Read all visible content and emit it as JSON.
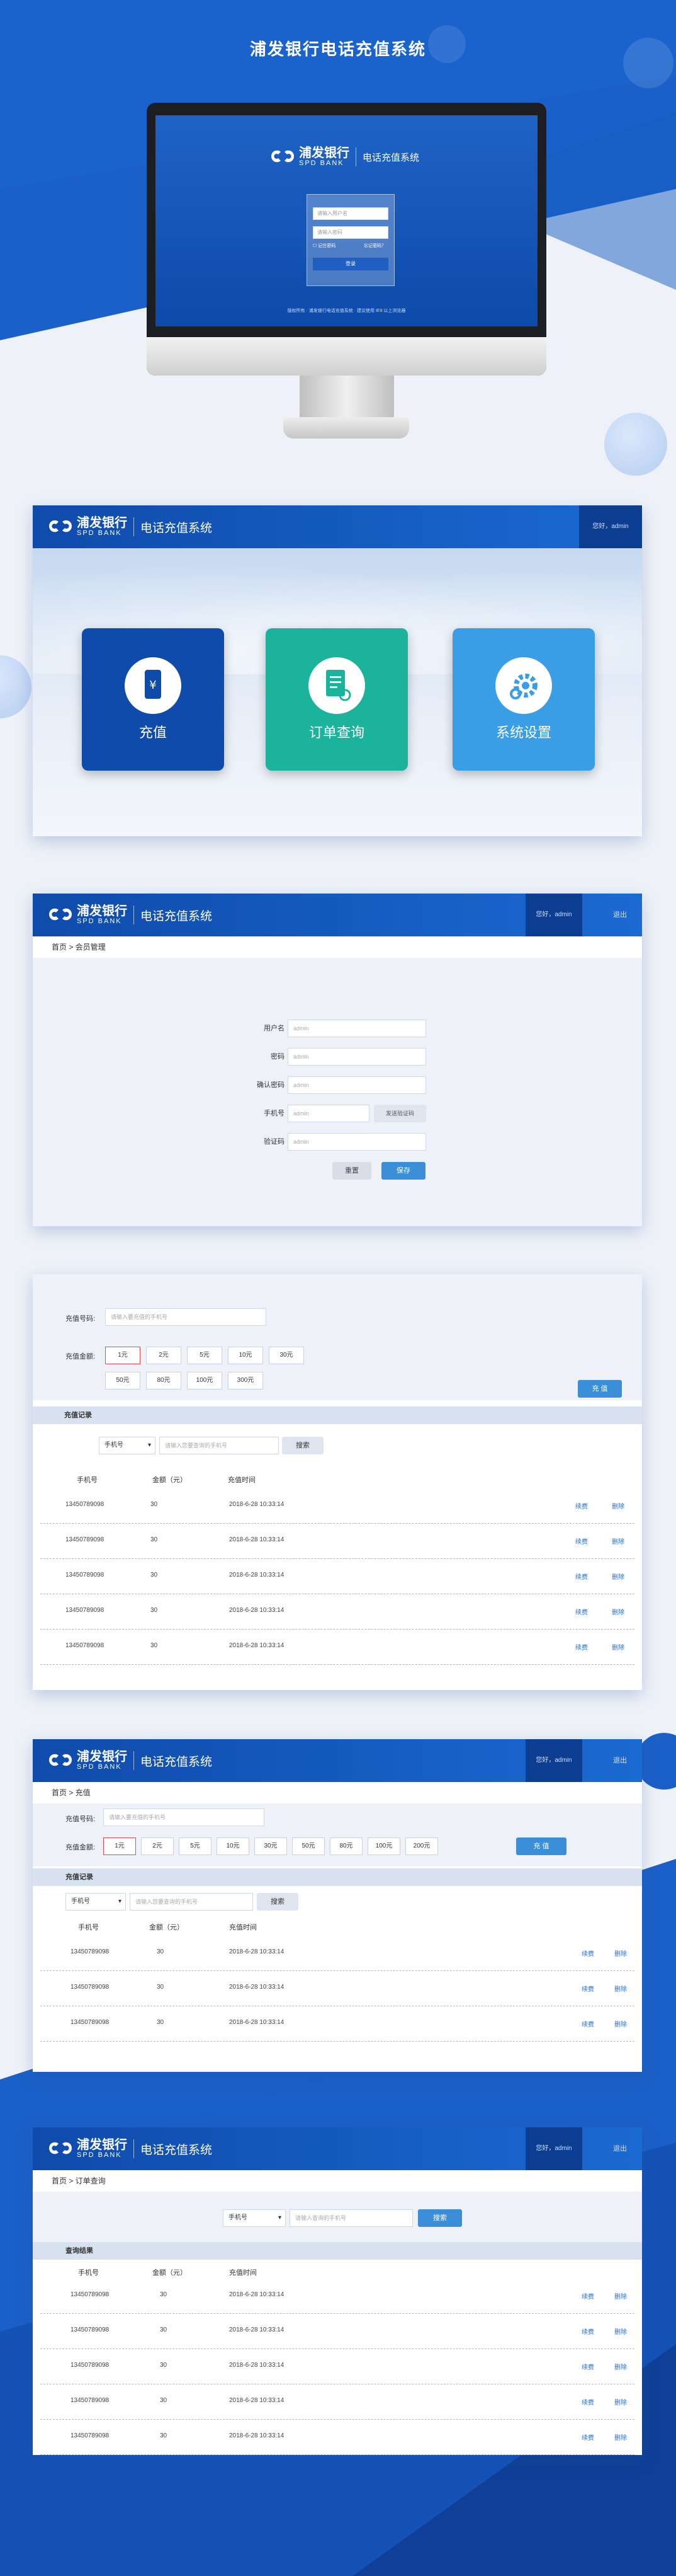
{
  "hero": {
    "title": "浦发银行电话充值系统"
  },
  "brand": {
    "cn": "浦发银行",
    "en": "SPD BANK",
    "system": "电话充值系统"
  },
  "login": {
    "user_placeholder": "请输入用户名",
    "pass_placeholder": "请输入密码",
    "remember": "记住密码",
    "forgot": "忘记密码？",
    "submit": "登录",
    "footer": "版权所有 · 浦发银行电话充值系统 · 建议使用 IE9 以上浏览器"
  },
  "header": {
    "user": "您好，admin",
    "exit": "退出"
  },
  "home": {
    "tiles": [
      {
        "label": "充值",
        "icon": "recharge-icon",
        "color": "#0f4bab"
      },
      {
        "label": "订单查询",
        "icon": "order-query-icon",
        "color": "#1bb39c"
      },
      {
        "label": "系统设置",
        "icon": "settings-gear-icon",
        "color": "#3a9ee6"
      }
    ]
  },
  "member": {
    "breadcrumb": "首页 > 会员管理",
    "fields": [
      {
        "label": "用户名",
        "value": "admin"
      },
      {
        "label": "密码",
        "value": "admin"
      },
      {
        "label": "确认密码",
        "value": "admin"
      },
      {
        "label": "手机号",
        "value": "admin"
      },
      {
        "label": "验证码",
        "value": "admin"
      }
    ],
    "send_code": "发送验证码",
    "reset": "重置",
    "save": "保存"
  },
  "recharge": {
    "breadcrumb": "首页 > 充值",
    "phone_label": "充值号码:",
    "phone_placeholder": "请输入要充值的手机号",
    "amount_label": "充值金额:",
    "amounts_a": [
      "1元",
      "2元",
      "5元",
      "10元",
      "30元",
      "50元",
      "80元",
      "100元",
      "300元"
    ],
    "amounts_b": [
      "1元",
      "2元",
      "5元",
      "10元",
      "30元",
      "50元",
      "80元",
      "100元",
      "200元"
    ],
    "submit": "充 值",
    "records_title": "充值记录",
    "filter_select": "手机号",
    "filter_placeholder": "请输入您要查询的手机号",
    "search": "搜索",
    "columns": [
      "手机号",
      "金额（元）",
      "充值时间"
    ],
    "rows": [
      {
        "phone": "13450789098",
        "amount": "30",
        "time": "2018-6-28 10:33:14",
        "a1": "续费",
        "a2": "删除"
      },
      {
        "phone": "13450789098",
        "amount": "30",
        "time": "2018-6-28 10:33:14",
        "a1": "续费",
        "a2": "删除"
      },
      {
        "phone": "13450789098",
        "amount": "30",
        "time": "2018-6-28 10:33:14",
        "a1": "续费",
        "a2": "删除"
      },
      {
        "phone": "13450789098",
        "amount": "30",
        "time": "2018-6-28 10:33:14",
        "a1": "续费",
        "a2": "删除"
      },
      {
        "phone": "13450789098",
        "amount": "30",
        "time": "2018-6-28 10:33:14",
        "a1": "续费",
        "a2": "删除"
      }
    ]
  },
  "orders": {
    "breadcrumb": "首页 > 订单查询",
    "filter_select": "手机号",
    "filter_placeholder": "请输入查询的手机号",
    "search": "搜索",
    "section": "查询结果",
    "columns": [
      "手机号",
      "金额（元）",
      "充值时间"
    ],
    "rows": [
      {
        "phone": "13450789098",
        "amount": "30",
        "time": "2018-6-28 10:33:14",
        "a1": "续费",
        "a2": "删除"
      },
      {
        "phone": "13450789098",
        "amount": "30",
        "time": "2018-6-28 10:33:14",
        "a1": "续费",
        "a2": "删除"
      },
      {
        "phone": "13450789098",
        "amount": "30",
        "time": "2018-6-28 10:33:14",
        "a1": "续费",
        "a2": "删除"
      },
      {
        "phone": "13450789098",
        "amount": "30",
        "time": "2018-6-28 10:33:14",
        "a1": "续费",
        "a2": "删除"
      },
      {
        "phone": "13450789098",
        "amount": "30",
        "time": "2018-6-28 10:33:14",
        "a1": "续费",
        "a2": "删除"
      }
    ]
  },
  "colors": {
    "primary": "#1a5fc4",
    "dark": "#0b3d91",
    "teal": "#1bb39c",
    "light": "#3a9ee6",
    "bg": "#eef2f8"
  }
}
